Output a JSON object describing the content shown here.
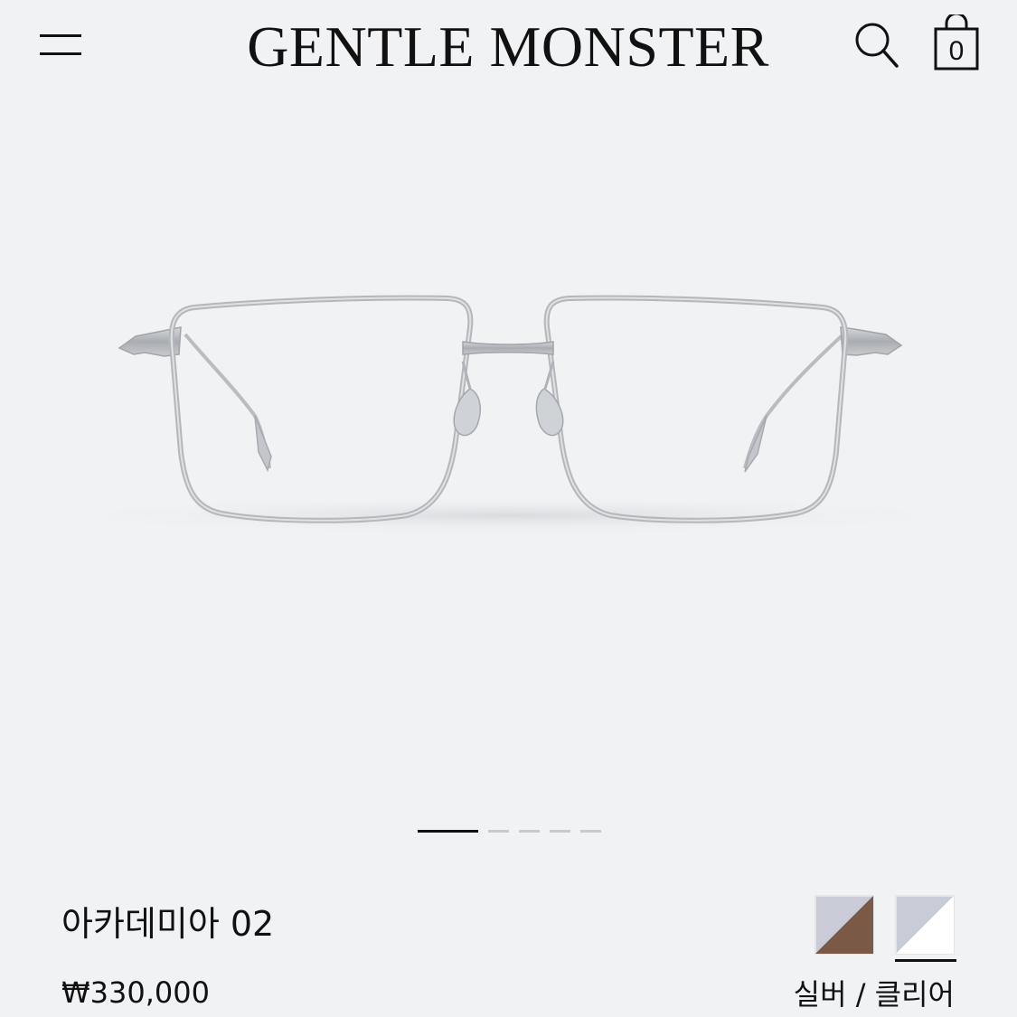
{
  "header": {
    "brand": "GENTLE MONSTER",
    "menu_icon": "hamburger-menu-icon",
    "search_icon": "search-icon",
    "cart_icon": "shopping-bag-icon",
    "cart_count": "0"
  },
  "gallery": {
    "image": "silver metal eyeglasses frame",
    "total_slides": 5,
    "active_slide": 1
  },
  "product": {
    "name": "아카데미아 02",
    "price": "₩330,000",
    "color_label": "실버 / 클리어",
    "swatches": [
      {
        "name": "silver-brown",
        "top": "#c9ccd6",
        "bottom": "#7a5a47",
        "selected": false
      },
      {
        "name": "silver-clear",
        "top": "#c9ccd6",
        "bottom": "#ffffff",
        "selected": true
      }
    ]
  },
  "colors": {
    "background": "#f1f2f4",
    "text": "#111111",
    "frame_metal": "#b7babe",
    "pager_inactive": "#c8cacd"
  }
}
